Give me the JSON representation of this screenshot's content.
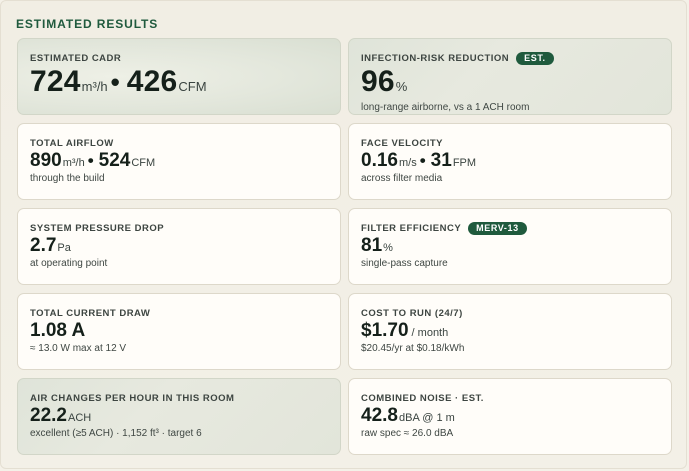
{
  "section_title": "ESTIMATED RESULTS",
  "cards": [
    {
      "label": "ESTIMATED CADR",
      "badge": "",
      "value1": "724",
      "unit1": "m³/h",
      "sep": "•",
      "value2": "426",
      "unit2": "CFM",
      "sub": ""
    },
    {
      "label": "INFECTION-RISK REDUCTION",
      "badge": "EST.",
      "value1": "96",
      "unit1": "%",
      "sub": "long-range airborne, vs a 1 ACH room"
    },
    {
      "label": "TOTAL AIRFLOW",
      "value1": "890",
      "unit1": "m³/h",
      "sep": "•",
      "value2": "524",
      "unit2": "CFM",
      "sub": "through the build"
    },
    {
      "label": "FACE VELOCITY",
      "value1": "0.16",
      "unit1": "m/s",
      "sep": "•",
      "value2": "31",
      "unit2": "FPM",
      "sub": "across filter media"
    },
    {
      "label": "SYSTEM PRESSURE DROP",
      "value1": "2.7",
      "unit1": "Pa",
      "sub": "at operating point"
    },
    {
      "label": "FILTER EFFICIENCY",
      "badge": "MERV-13",
      "value1": "81",
      "unit1": "%",
      "sub": "single-pass capture"
    },
    {
      "label": "TOTAL CURRENT DRAW",
      "value1": "1.08 A",
      "unit1": "",
      "sub": "≈ 13.0 W max at 12 V"
    },
    {
      "label": "COST TO RUN (24/7)",
      "value1": "$1.70",
      "unit1": "/ month",
      "sub": "$20.45/yr at $0.18/kWh"
    },
    {
      "label": "AIR CHANGES PER HOUR IN THIS ROOM",
      "value1": "22.2",
      "unit1": "ACH",
      "sub": "excellent (≥5 ACH) · 1,152 ft³ · target 6"
    },
    {
      "label": "COMBINED NOISE · EST.",
      "value1": "42.8",
      "unit1": "dBA @ 1 m",
      "sub": "raw spec ≈ 26.0 dBA"
    }
  ]
}
